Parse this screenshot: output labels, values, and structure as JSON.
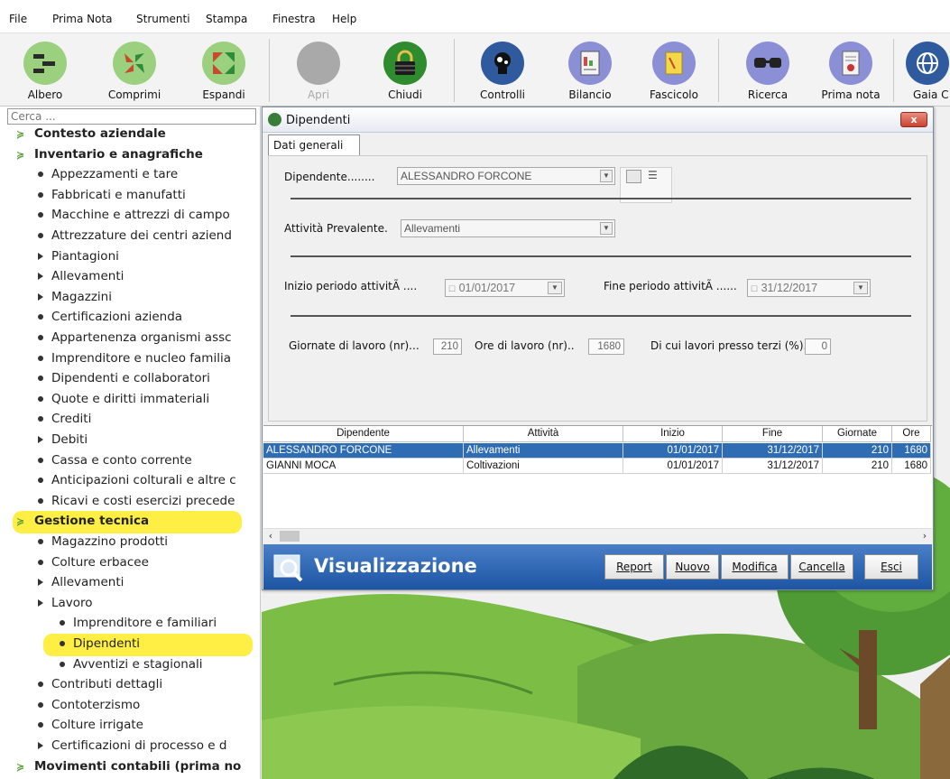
{
  "menubar": {
    "items": [
      "File",
      "Prima Nota",
      "Strumenti",
      "Stampa",
      "Finestra",
      "Help"
    ]
  },
  "toolbar": {
    "buttons": [
      {
        "label": "Albero",
        "icon": "tree-icon",
        "color": "#9bd07f"
      },
      {
        "label": "Comprimi",
        "icon": "collapse-arrows-icon",
        "color": "#9bd07f"
      },
      {
        "label": "Espandi",
        "icon": "expand-arrows-icon",
        "color": "#9bd07f"
      },
      {
        "label": "Apri",
        "icon": "open-icon",
        "color": "#a9a9a9"
      },
      {
        "label": "Chiudi",
        "icon": "padlock-icon",
        "color": "#2e8b2e"
      },
      {
        "label": "Controlli",
        "icon": "gears-icon",
        "color": "#2f5b9e"
      },
      {
        "label": "Bilancio",
        "icon": "balance-sheet-icon",
        "color": "#8a8fd6"
      },
      {
        "label": "Fascicolo",
        "icon": "folder-icon",
        "color": "#8a8fd6"
      },
      {
        "label": "Ricerca",
        "icon": "glasses-icon",
        "color": "#8a8fd6"
      },
      {
        "label": "Prima nota",
        "icon": "document-icon",
        "color": "#8a8fd6"
      },
      {
        "label": "Gaia C",
        "icon": "globe-icon",
        "color": "#2f5b9e"
      }
    ]
  },
  "search": {
    "placeholder": "Cerca ..."
  },
  "tree": [
    {
      "label": "Contesto aziendale",
      "level": 0
    },
    {
      "label": "Inventario e anagrafiche",
      "level": 0
    },
    {
      "label": "Appezzamenti e tare",
      "level": 1
    },
    {
      "label": "Fabbricati e manufatti",
      "level": 1
    },
    {
      "label": "Macchine e attrezzi di campo",
      "level": 1
    },
    {
      "label": "Attrezzature dei centri aziend",
      "level": 1
    },
    {
      "label": "Piantagioni",
      "level": 1
    },
    {
      "label": "Allevamenti",
      "level": 1
    },
    {
      "label": "Magazzini",
      "level": 1
    },
    {
      "label": "Certificazioni azienda",
      "level": 1
    },
    {
      "label": "Appartenenza organismi assc",
      "level": 1
    },
    {
      "label": "Imprenditore e nucleo familia",
      "level": 1
    },
    {
      "label": "Dipendenti e collaboratori",
      "level": 1
    },
    {
      "label": "Quote e diritti immateriali",
      "level": 1
    },
    {
      "label": "Crediti",
      "level": 1
    },
    {
      "label": "Debiti",
      "level": 1
    },
    {
      "label": "Cassa e conto corrente",
      "level": 1
    },
    {
      "label": "Anticipazioni colturali e altre c",
      "level": 1
    },
    {
      "label": "Ricavi e costi esercizi precede",
      "level": 1
    },
    {
      "label": "Gestione tecnica",
      "level": 0
    },
    {
      "label": "Magazzino prodotti",
      "level": 1
    },
    {
      "label": "Colture erbacee",
      "level": 1
    },
    {
      "label": "Allevamenti",
      "level": 1
    },
    {
      "label": "Lavoro",
      "level": 1
    },
    {
      "label": "Imprenditore e familiari",
      "level": 2
    },
    {
      "label": "Dipendenti",
      "level": 2
    },
    {
      "label": "Avventizi e stagionali",
      "level": 2
    },
    {
      "label": "Contributi dettagli",
      "level": 1
    },
    {
      "label": "Contoterzismo",
      "level": 1
    },
    {
      "label": "Colture irrigate",
      "level": 1
    },
    {
      "label": "Certificazioni di processo e d",
      "level": 1
    },
    {
      "label": "Movimenti contabili (prima no",
      "level": 0
    }
  ],
  "window": {
    "title": "Dipendenti",
    "close_label": "x",
    "tab": "Dati generali",
    "form": {
      "dipendente_label": "Dipendente........",
      "dipendente_value": "ALESSANDRO FORCONE",
      "attivita_label": "Attività Prevalente.",
      "attivita_value": "Allevamenti",
      "inizio_label": "Inizio periodo attivitÃ ....",
      "inizio_value": "01/01/2017",
      "fine_label": "Fine periodo attivitÃ ......",
      "fine_value": "31/12/2017",
      "giornate_label": "Giornate di lavoro (nr)...",
      "giornate_value": "210",
      "ore_label": "Ore di lavoro (nr)..",
      "ore_value": "1680",
      "terzi_label": "Di cui lavori presso terzi (%).",
      "terzi_value": "0"
    },
    "grid": {
      "columns": [
        "Dipendente",
        "Attività",
        "Inizio",
        "Fine",
        "Giornate",
        "Ore"
      ],
      "rows": [
        [
          "ALESSANDRO FORCONE",
          "Allevamenti",
          "01/01/2017",
          "31/12/2017",
          "210",
          "1680"
        ],
        [
          "GIANNI MOCA",
          "Coltivazioni",
          "01/01/2017",
          "31/12/2017",
          "210",
          "1680"
        ]
      ]
    },
    "footer": {
      "mode": "Visualizzazione",
      "buttons": [
        "Report",
        "Nuovo",
        "Modifica",
        "Cancella",
        "Esci"
      ]
    }
  }
}
